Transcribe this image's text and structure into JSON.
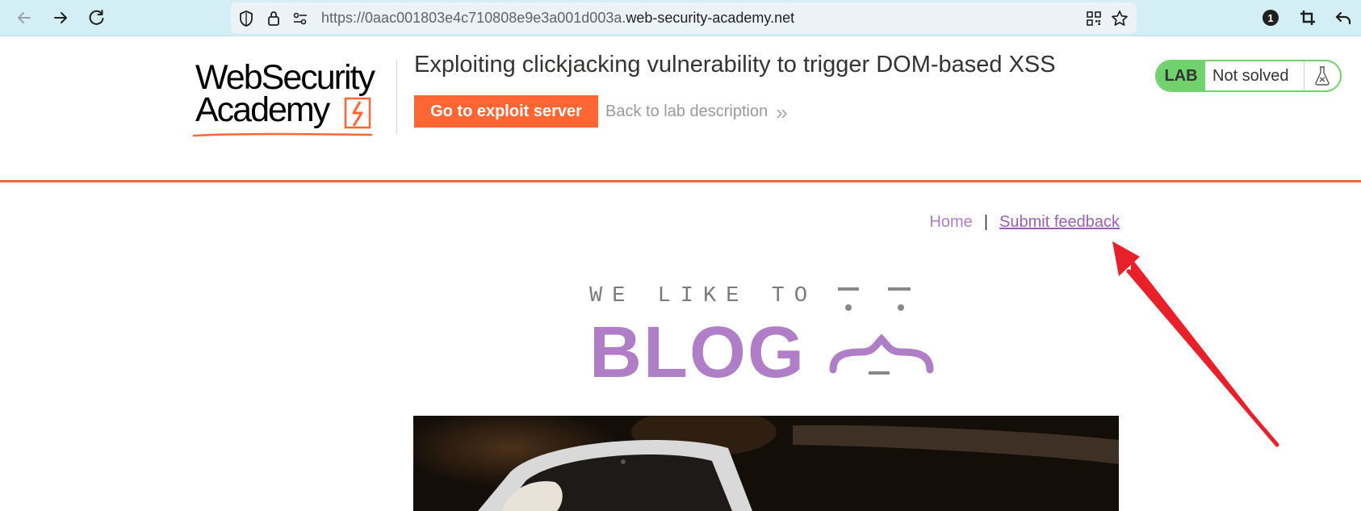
{
  "browser": {
    "url_scheme": "https://",
    "url_subdomain": "0aac001803e4c710808e9e3a001d003a.",
    "url_host": "web-security-academy.net",
    "extension_badge": "1"
  },
  "lab": {
    "logo_line1": "WebSecurity",
    "logo_line2": "Academy",
    "title": "Exploiting clickjacking vulnerability to trigger DOM-based XSS",
    "exploit_button": "Go to exploit server",
    "back_link": "Back to lab description",
    "back_link_chevron": "»",
    "status_badge": "LAB",
    "status_text": "Not solved"
  },
  "blog": {
    "nav": {
      "home": "Home",
      "separator": "|",
      "feedback": "Submit feedback"
    },
    "banner_tagline": "WE LIKE TO",
    "banner_title": "BLOG"
  },
  "colors": {
    "accent_orange": "#ff6633",
    "lab_green": "#70d16d",
    "blog_purple": "#b07dc7",
    "annotation_red": "#e8202a"
  }
}
